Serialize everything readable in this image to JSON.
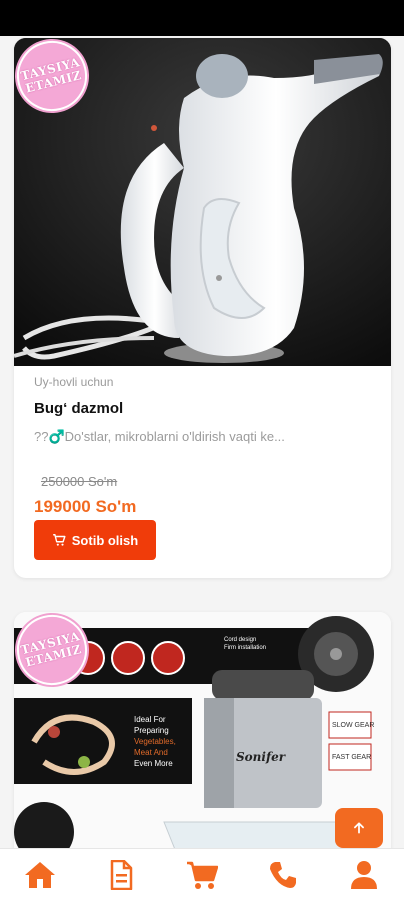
{
  "badge": {
    "line1": "TAYSIYA",
    "line2": "ETAMIZ"
  },
  "product1": {
    "category": "Uy-hovli uchun",
    "title": "Bug‘ dazmol",
    "description": "??♂️Do'stlar, mikroblarni o'ldirish vaqti ke...",
    "old_price": "250000 So'm",
    "price": "199000 So'm",
    "buy_label": "Sotib olish"
  },
  "product2": {
    "banner_note": "Cord design\nFirm installation",
    "features": [
      "Ideal For",
      "Preparing",
      "Vegetables,",
      "Meat And",
      "Even More"
    ],
    "brand": "Sonifer",
    "gear1": "SLOW GEAR",
    "gear2": "FAST GEAR"
  },
  "icons": {
    "cart": "cart-icon",
    "scroll_top": "arrow-up-icon",
    "nav": [
      "home-icon",
      "document-icon",
      "cart-icon",
      "phone-icon",
      "user-icon"
    ]
  },
  "colors": {
    "accent": "#f26a21",
    "button": "#f03c0a",
    "badge": "#f4a8d6"
  }
}
